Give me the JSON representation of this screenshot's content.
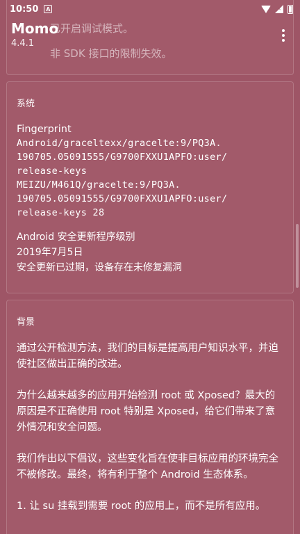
{
  "status_bar": {
    "time": "10:50",
    "notif_glyph": "A"
  },
  "app_bar": {
    "title": "Momo",
    "version": "4.4.1"
  },
  "ghost_text": {
    "line1": "已开启调试模式。",
    "line2": "非 SDK 接口的限制失效。"
  },
  "system_card": {
    "title": "系统",
    "fingerprint_label": "Fingerprint",
    "fingerprint_lines": [
      "Android/graceltexx/gracelte:9/PQ3A.",
      "190705.05091555/G9700FXXU1APFO:user/",
      "release-keys",
      "MEIZU/M461Q/gracelte:9/PQ3A.",
      "190705.05091555/G9700FXXU1APFO:user/",
      "release-keys 28"
    ],
    "security_label": "Android 安全更新程序级别",
    "security_date": "2019年7月5日",
    "security_status": "安全更新已过期，设备存在未修复漏洞"
  },
  "background_card": {
    "title": "背景",
    "paragraphs": [
      "通过公开检测方法，我们的目标是提高用户知识水平，并迫使社区做出正确的改进。",
      "为什么越来越多的应用开始检测 root 或 Xposed？最大的原因是不正确使用 root 特别是 Xposed，给它们带来了意外情况和安全问题。",
      "我们作出以下倡议，这些变化旨在使非目标应用的环境完全不被修改。最终，将有利于整个 Android 生态体系。",
      "1. 让 su 挂载到需要 root 的应用上，而不是所有应用。"
    ]
  }
}
